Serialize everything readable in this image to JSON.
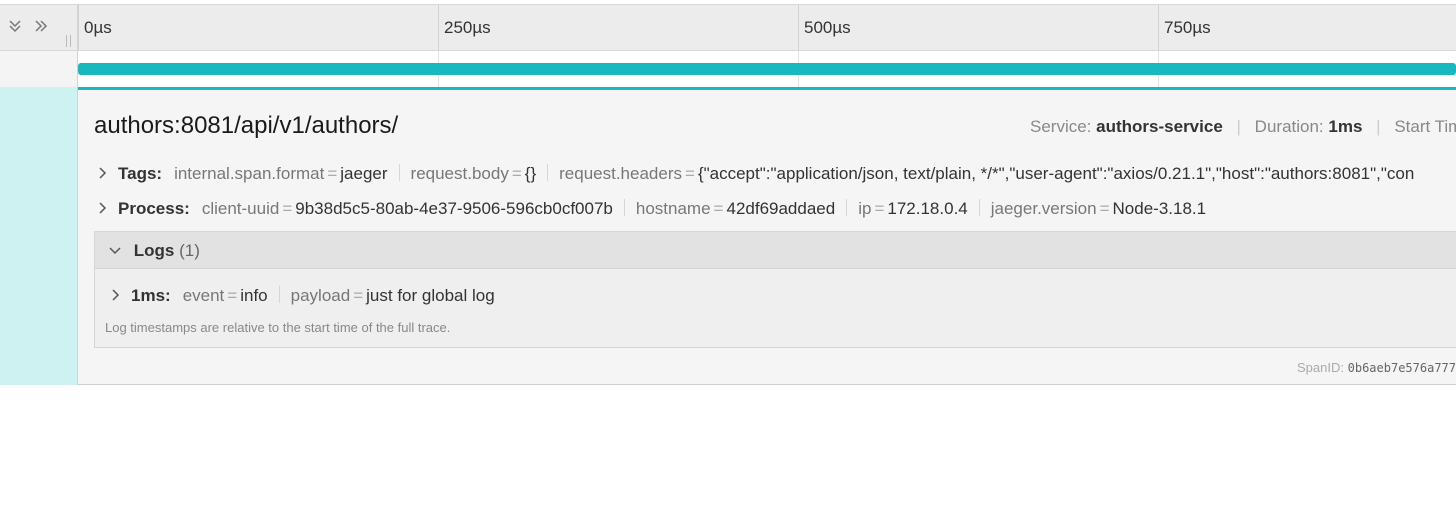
{
  "header": {
    "ticks": [
      "0µs",
      "250µs",
      "500µs",
      "750µs"
    ]
  },
  "colors": {
    "span_bar": "#17b8be",
    "details_left": "#cef1f2"
  },
  "icons": {
    "collapse_all": "double-chevron-down-icon",
    "expand": "double-chevron-right-icon",
    "toggle": "chevron-right-icon"
  },
  "span": {
    "operation": "authors:8081/api/v1/authors/",
    "overview": {
      "service_label": "Service:",
      "service_value": "authors-service",
      "duration_label": "Duration:",
      "duration_value": "1ms",
      "start_label": "Start Time"
    },
    "tags": {
      "label": "Tags:",
      "items": [
        {
          "key": "internal.span.format",
          "value": "jaeger"
        },
        {
          "key": "request.body",
          "value": "{}"
        },
        {
          "key": "request.headers",
          "value": "{\"accept\":\"application/json, text/plain, */*\",\"user-agent\":\"axios/0.21.1\",\"host\":\"authors:8081\",\"con"
        }
      ]
    },
    "process": {
      "label": "Process:",
      "items": [
        {
          "key": "client-uuid",
          "value": "9b38d5c5-80ab-4e37-9506-596cb0cf007b"
        },
        {
          "key": "hostname",
          "value": "42df69addaed"
        },
        {
          "key": "ip",
          "value": "172.18.0.4"
        },
        {
          "key": "jaeger.version",
          "value": "Node-3.18.1"
        }
      ]
    },
    "logs": {
      "title": "Logs",
      "count": "(1)",
      "entries": [
        {
          "time": "1ms:",
          "fields": [
            {
              "key": "event",
              "value": "info"
            },
            {
              "key": "payload",
              "value": "just for global log"
            }
          ]
        }
      ],
      "note": "Log timestamps are relative to the start time of the full trace."
    },
    "span_id_label": "SpanID:",
    "span_id_value": "0b6aeb7e576a777"
  }
}
